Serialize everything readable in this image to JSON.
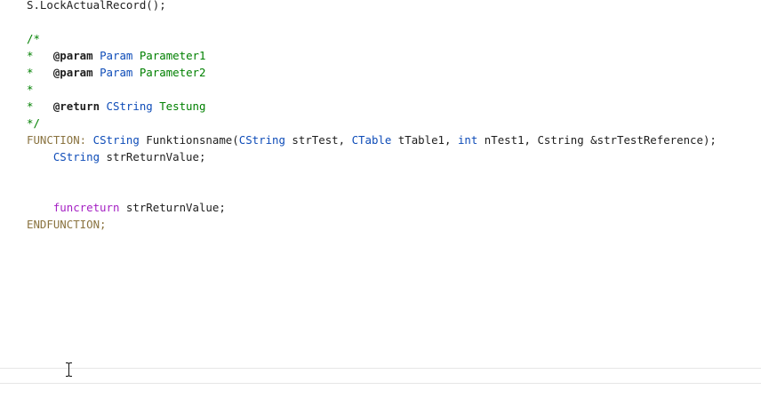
{
  "colors": {
    "plain": "#1e1e1e",
    "comment": "#008000",
    "doc_tag": "#1e1e1e",
    "type": "#0e4cb8",
    "keyword": "#8a7340",
    "flow_keyword": "#a521c4",
    "background": "#ffffff"
  },
  "code": {
    "lines": [
      {
        "tokens": [
          {
            "t": "S.LockActualRecord();",
            "c": "plain"
          }
        ]
      },
      {
        "tokens": []
      },
      {
        "tokens": [
          {
            "t": "/*",
            "c": "comment"
          }
        ]
      },
      {
        "tokens": [
          {
            "t": "*   ",
            "c": "comment"
          },
          {
            "t": "@param",
            "c": "doc_tag",
            "b": true
          },
          {
            "t": " ",
            "c": "comment"
          },
          {
            "t": "Param",
            "c": "type"
          },
          {
            "t": " Parameter1",
            "c": "comment"
          }
        ]
      },
      {
        "tokens": [
          {
            "t": "*   ",
            "c": "comment"
          },
          {
            "t": "@param",
            "c": "doc_tag",
            "b": true
          },
          {
            "t": " ",
            "c": "comment"
          },
          {
            "t": "Param",
            "c": "type"
          },
          {
            "t": " Parameter2",
            "c": "comment"
          }
        ]
      },
      {
        "tokens": [
          {
            "t": "*",
            "c": "comment"
          }
        ]
      },
      {
        "tokens": [
          {
            "t": "*   ",
            "c": "comment"
          },
          {
            "t": "@return",
            "c": "doc_tag",
            "b": true
          },
          {
            "t": " ",
            "c": "comment"
          },
          {
            "t": "CString",
            "c": "type"
          },
          {
            "t": " Testung",
            "c": "comment"
          }
        ]
      },
      {
        "tokens": [
          {
            "t": "*/",
            "c": "comment"
          }
        ]
      },
      {
        "tokens": [
          {
            "t": "FUNCTION:",
            "c": "keyword"
          },
          {
            "t": " ",
            "c": "plain"
          },
          {
            "t": "CString",
            "c": "type"
          },
          {
            "t": " Funktionsname(",
            "c": "plain"
          },
          {
            "t": "CString",
            "c": "type"
          },
          {
            "t": " strTest, ",
            "c": "plain"
          },
          {
            "t": "CTable",
            "c": "type"
          },
          {
            "t": " tTable1, ",
            "c": "plain"
          },
          {
            "t": "int",
            "c": "type"
          },
          {
            "t": " nTest1, Cstring &strTestReference);",
            "c": "plain"
          }
        ]
      },
      {
        "tokens": [
          {
            "t": "    ",
            "c": "plain"
          },
          {
            "t": "CString",
            "c": "type"
          },
          {
            "t": " strReturnValue;",
            "c": "plain"
          }
        ]
      },
      {
        "tokens": []
      },
      {
        "tokens": []
      },
      {
        "tokens": [
          {
            "t": "    ",
            "c": "plain"
          },
          {
            "t": "funcreturn",
            "c": "flow_keyword"
          },
          {
            "t": " strReturnValue;",
            "c": "plain"
          }
        ]
      },
      {
        "tokens": [
          {
            "t": "ENDFUNCTION;",
            "c": "keyword"
          }
        ]
      }
    ]
  }
}
